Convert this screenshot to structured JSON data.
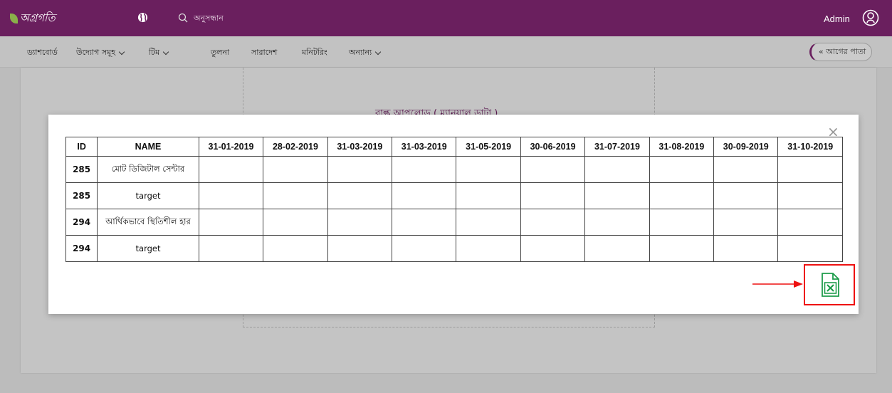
{
  "header": {
    "logo_text": "অগ্রগতি",
    "search_placeholder": "অনুসন্ধান",
    "user_name": "Admin",
    "brand_color": "#6a1f5e"
  },
  "nav": {
    "items": [
      {
        "label": "ড্যাশবোর্ড",
        "dropdown": false
      },
      {
        "label": "উদ্যোগ সমূহ",
        "dropdown": true
      },
      {
        "label": "টিম",
        "dropdown": true
      },
      {
        "label": "তুলনা",
        "dropdown": false
      },
      {
        "label": "সারাদেশ",
        "dropdown": false
      },
      {
        "label": "মনিটরিং",
        "dropdown": false
      },
      {
        "label": "অন্যান্য",
        "dropdown": true
      }
    ],
    "back_label": "« আগের পাতা"
  },
  "background": {
    "title": "বাল্ক আপলোড ( ম্যানুয়াল ডাটা )"
  },
  "modal": {
    "close_symbol": "×",
    "columns": [
      "ID",
      "NAME",
      "31-01-2019",
      "28-02-2019",
      "31-03-2019",
      "31-03-2019",
      "31-05-2019",
      "30-06-2019",
      "31-07-2019",
      "31-08-2019",
      "30-09-2019",
      "31-10-2019"
    ],
    "rows": [
      {
        "id": "285",
        "name": "মোট ডিজিটাল সেন্টার"
      },
      {
        "id": "285",
        "name": "target"
      },
      {
        "id": "294",
        "name": "আর্থিকভাবে স্থিতিশীল হার"
      },
      {
        "id": "294",
        "name": "target"
      }
    ],
    "export_icon": "excel-file-icon",
    "export_color": "#1f9d4c",
    "highlight_color": "#e11111"
  }
}
